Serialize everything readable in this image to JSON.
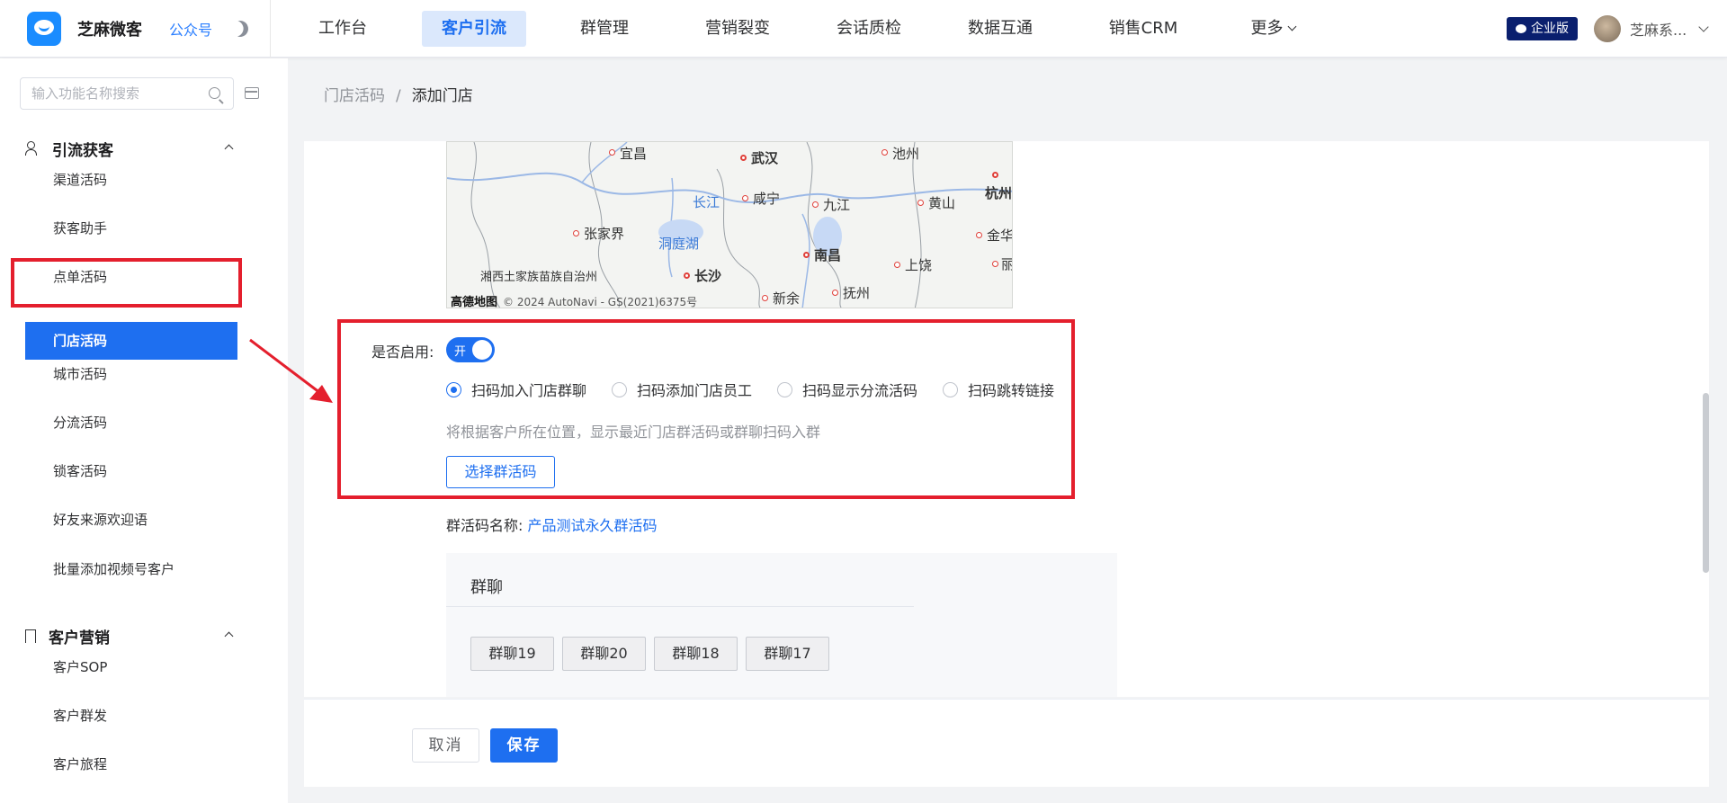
{
  "app": {
    "name": "芝麻微客",
    "sub_link": "公众号"
  },
  "nav": {
    "items": [
      "工作台",
      "客户引流",
      "群管理",
      "营销裂变",
      "会话质检",
      "数据互通",
      "销售CRM"
    ],
    "more": "更多",
    "active": "客户引流"
  },
  "header": {
    "edition_badge": "企业版",
    "user_name": "芝麻系..."
  },
  "sidebar": {
    "search_placeholder": "输入功能名称搜索",
    "group1": {
      "title": "引流获客",
      "items": [
        "渠道活码",
        "获客助手",
        "点单活码",
        "门店活码",
        "城市活码",
        "分流活码",
        "锁客活码",
        "好友来源欢迎语",
        "批量添加视频号客户"
      ]
    },
    "group2": {
      "title": "客户营销",
      "items": [
        "客户SOP",
        "客户群发",
        "客户旅程"
      ]
    },
    "active_item": "门店活码"
  },
  "breadcrumb": {
    "parent": "门店活码",
    "separator": "/",
    "current": "添加门店"
  },
  "map": {
    "cities": [
      "宜昌",
      "武汉",
      "池州",
      "杭州",
      "长江",
      "咸宁",
      "九江",
      "黄山",
      "张家界",
      "洞庭湖",
      "金华",
      "南昌",
      "上饶",
      "丽水",
      "湘西土家族苗族自治州",
      "长沙",
      "新余",
      "抚州"
    ],
    "provider": "高德地图",
    "copyright": "© 2024 AutoNavi - GS(2021)6375号"
  },
  "form": {
    "enable_label": "是否启用:",
    "toggle_text": "开",
    "enabled": true,
    "radio_options": [
      "扫码加入门店群聊",
      "扫码添加门店员工",
      "扫码显示分流活码",
      "扫码跳转链接"
    ],
    "selected_option": "扫码加入门店群聊",
    "hint": "将根据客户所在位置，显示最近门店群活码或群聊扫码入群",
    "choose_button": "选择群活码",
    "group_code_label": "群活码名称:",
    "group_code_value": "产品测试永久群活码",
    "chat_section_title": "群聊",
    "chat_tags": [
      "群聊19",
      "群聊20",
      "群聊18",
      "群聊17"
    ]
  },
  "footer": {
    "cancel": "取消",
    "save": "保存"
  },
  "colors": {
    "accent": "#1e6ff0",
    "highlight": "#e41f2d",
    "brand_dark": "#0a1f6e"
  }
}
